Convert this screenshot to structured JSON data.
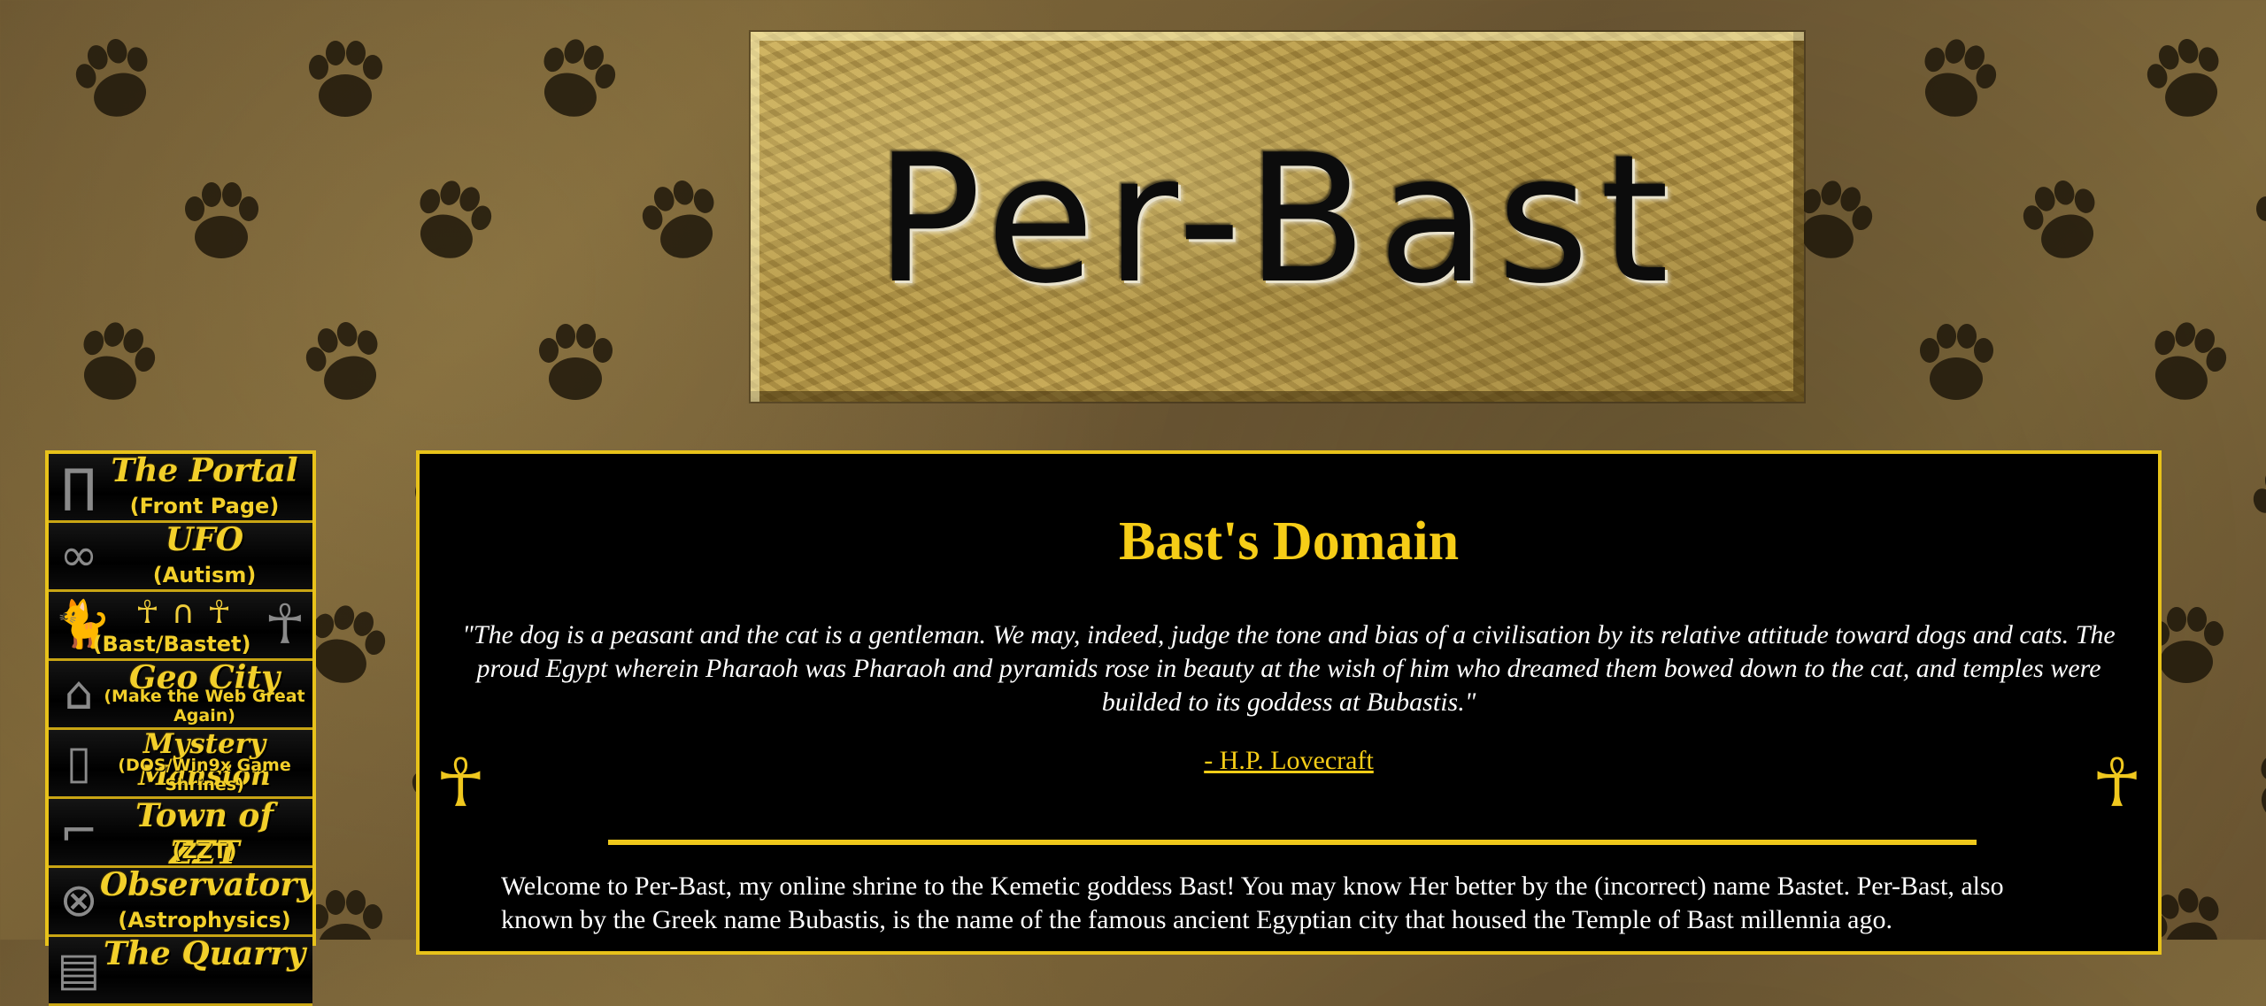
{
  "banner": {
    "title": "Per-Bast"
  },
  "nav": {
    "items": [
      {
        "title": "The Portal",
        "subtitle": "(Front Page)",
        "icon": "doorway-icon"
      },
      {
        "title": "UFO",
        "subtitle": "(Autism)",
        "icon": "chain-icon"
      },
      {
        "title": "",
        "subtitle": "(Bast/Bastet)",
        "icon": "cat-icon"
      },
      {
        "title": "Geo City",
        "subtitle": "(Make the Web Great Again)",
        "icon": "city-icon"
      },
      {
        "title": "Mystery Mansion",
        "subtitle": "(DOS/Win9x Game Shrines)",
        "icon": "mansion-icon"
      },
      {
        "title": "Town of ZZT",
        "subtitle": "(ZZT)",
        "icon": "zzt-icon"
      },
      {
        "title": "Observatory",
        "subtitle": "(Astrophysics)",
        "icon": "telescope-icon"
      },
      {
        "title": "The Quarry",
        "subtitle": "",
        "icon": "quarry-icon"
      }
    ]
  },
  "content": {
    "heading": "Bast's Domain",
    "quote": "\"The dog is a peasant and the cat is a gentleman. We may, indeed, judge the tone and bias of a civilisation by its relative attitude toward dogs and cats. The proud Egypt wherein Pharaoh was Pharaoh and pyramids rose in beauty at the wish of him who dreamed them bowed down to the cat, and temples were builded to its goddess at Bubastis.\"",
    "author": "- H.P. Lovecraft",
    "welcome": "Welcome to Per-Bast, my online shrine to the Kemetic goddess Bast! You may know Her better by the (incorrect) name Bastet. Per-Bast, also known by the Greek name Bubastis, is the name of the famous ancient Egyptian city that housed the Temple of Bast millennia ago."
  },
  "colors": {
    "gold": "#f6cd17",
    "border": "#e8c21a",
    "panel": "#000000",
    "background": "#6f5934"
  }
}
